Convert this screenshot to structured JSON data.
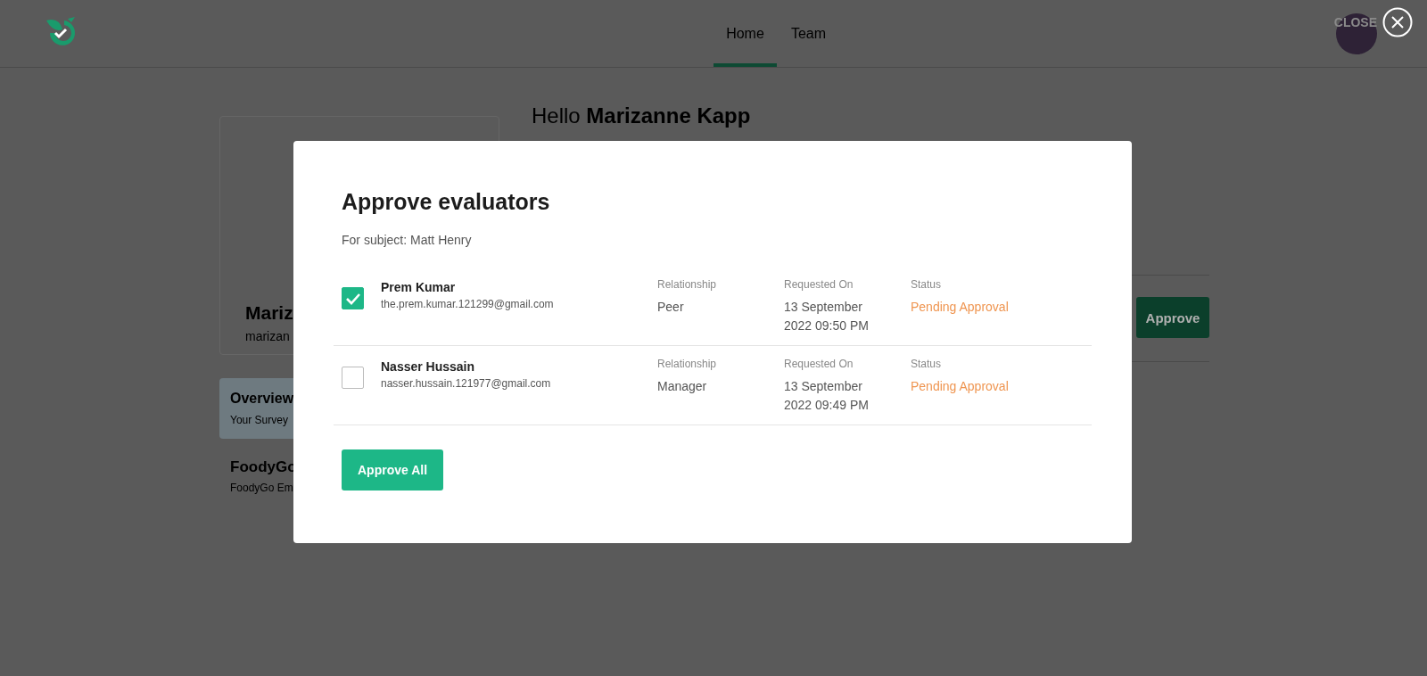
{
  "nav": {
    "tabs": [
      {
        "label": "Home",
        "selected": true
      },
      {
        "label": "Team",
        "selected": false
      }
    ]
  },
  "close": {
    "label": "CLOSE"
  },
  "profile": {
    "name": "Mariz",
    "email": "marizan"
  },
  "overview": {
    "title": "Overview",
    "subtitle": "Your Survey"
  },
  "survey": {
    "title": "FoodyGo",
    "subtitle": "FoodyGo Em"
  },
  "greeting": {
    "prefix": "Hello",
    "name": "Marizanne Kapp"
  },
  "background_button": "Approve",
  "modal": {
    "title": "Approve evaluators",
    "subtitle": "For subject: Matt Henry",
    "rows": [
      {
        "checked": true,
        "name": "Prem Kumar",
        "email": "the.prem.kumar.121299@gmail.com",
        "relationship_label": "Relationship",
        "relationship": "Peer",
        "requested_label": "Requested On",
        "requested_date": "13 September",
        "requested_time": "2022 09:50 PM",
        "status_label": "Status",
        "status": "Pending Approval"
      },
      {
        "checked": false,
        "name": "Nasser Hussain",
        "email": "nasser.hussain.121977@gmail.com",
        "relationship_label": "Relationship",
        "relationship": "Manager",
        "requested_label": "Requested On",
        "requested_date": "13 September",
        "requested_time": "2022 09:49 PM",
        "status_label": "Status",
        "status": "Pending Approval"
      }
    ],
    "button": "Approve All"
  }
}
